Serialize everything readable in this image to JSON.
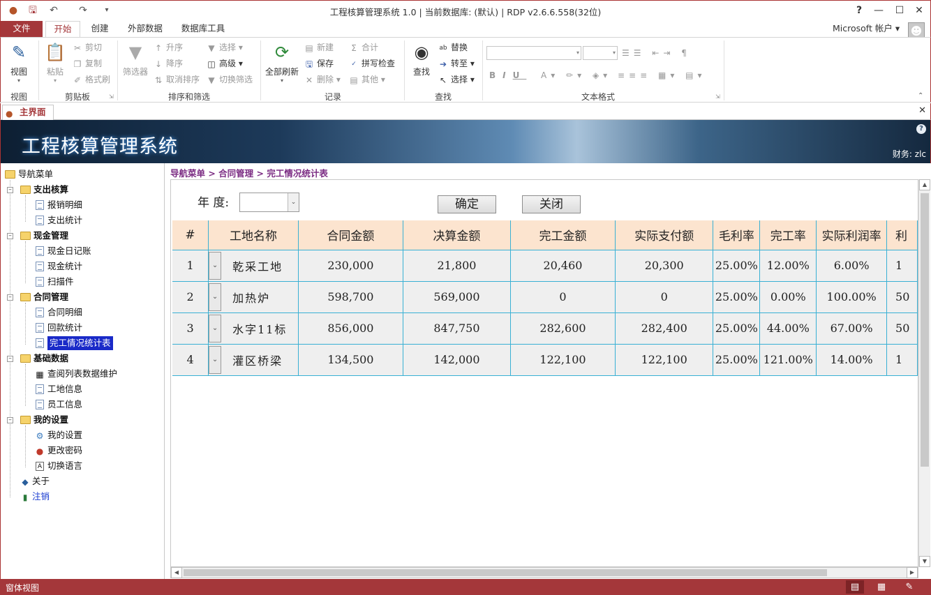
{
  "window": {
    "title": "工程核算管理系统 1.0 | 当前数据库: (默认) | RDP v2.6.6.558(32位)",
    "account": "Microsoft 帐户"
  },
  "ribbon": {
    "tabs": [
      "文件",
      "开始",
      "创建",
      "外部数据",
      "数据库工具"
    ],
    "groups": {
      "view": {
        "label": "视图",
        "btn": "视图"
      },
      "clipboard": {
        "label": "剪贴板",
        "paste": "粘贴",
        "cut": "剪切",
        "copy": "复制",
        "format": "格式刷"
      },
      "sort": {
        "label": "排序和筛选",
        "filter": "筛选器",
        "asc": "升序",
        "desc": "降序",
        "clear": "取消排序",
        "select": "选择",
        "advanced": "高级",
        "toggle": "切换筛选"
      },
      "records": {
        "label": "记录",
        "refresh": "全部刷新",
        "new": "新建",
        "save": "保存",
        "delete": "删除",
        "sum": "合计",
        "spell": "拼写检查",
        "more": "其他"
      },
      "find": {
        "label": "查找",
        "find": "查找",
        "replace": "替换",
        "goto": "转至",
        "select": "选择"
      },
      "textformat": {
        "label": "文本格式"
      }
    }
  },
  "doc_tab": {
    "label": "主界面"
  },
  "banner": {
    "title": "工程核算管理系统",
    "user": "财务: zlc"
  },
  "nav": {
    "root": "导航菜单",
    "g1": "支出核算",
    "g1i1": "报销明细",
    "g1i2": "支出统计",
    "g2": "现金管理",
    "g2i1": "现金日记账",
    "g2i2": "现金统计",
    "g2i3": "扫描件",
    "g3": "合同管理",
    "g3i1": "合同明细",
    "g3i2": "回款统计",
    "g3i3": "完工情况统计表",
    "g4": "基础数据",
    "g4i1": "查阅列表数据维护",
    "g4i2": "工地信息",
    "g4i3": "员工信息",
    "g5": "我的设置",
    "g5i1": "我的设置",
    "g5i2": "更改密码",
    "g5i3": "切换语言",
    "about": "关于",
    "logout": "注销"
  },
  "breadcrumb": "导航菜单 > 合同管理 > 完工情况统计表",
  "form": {
    "year_label": "年 度:",
    "year_value": "",
    "ok": "确定",
    "close": "关闭"
  },
  "table": {
    "headers": [
      "#",
      "工地名称",
      "合同金额",
      "决算金额",
      "完工金额",
      "实际支付额",
      "毛利率",
      "完工率",
      "实际利润率",
      "利"
    ],
    "rows": [
      {
        "no": "1",
        "site": "乾采工地",
        "contract": "230,000",
        "settle": "21,800",
        "done": "20,460",
        "paid": "20,300",
        "gross": "25.00%",
        "rate": "12.00%",
        "profit": "6.00%",
        "extra": "1"
      },
      {
        "no": "2",
        "site": "加热炉",
        "contract": "598,700",
        "settle": "569,000",
        "done": "0",
        "paid": "0",
        "gross": "25.00%",
        "rate": "0.00%",
        "profit": "100.00%",
        "extra": "50"
      },
      {
        "no": "3",
        "site": "水字11标",
        "contract": "856,000",
        "settle": "847,750",
        "done": "282,600",
        "paid": "282,400",
        "gross": "25.00%",
        "rate": "44.00%",
        "profit": "67.00%",
        "extra": "50"
      },
      {
        "no": "4",
        "site": "灌区桥梁",
        "contract": "134,500",
        "settle": "142,000",
        "done": "122,100",
        "paid": "122,100",
        "gross": "25.00%",
        "rate": "121.00%",
        "profit": "14.00%",
        "extra": "1"
      }
    ]
  },
  "status": {
    "text": "窗体视图"
  }
}
